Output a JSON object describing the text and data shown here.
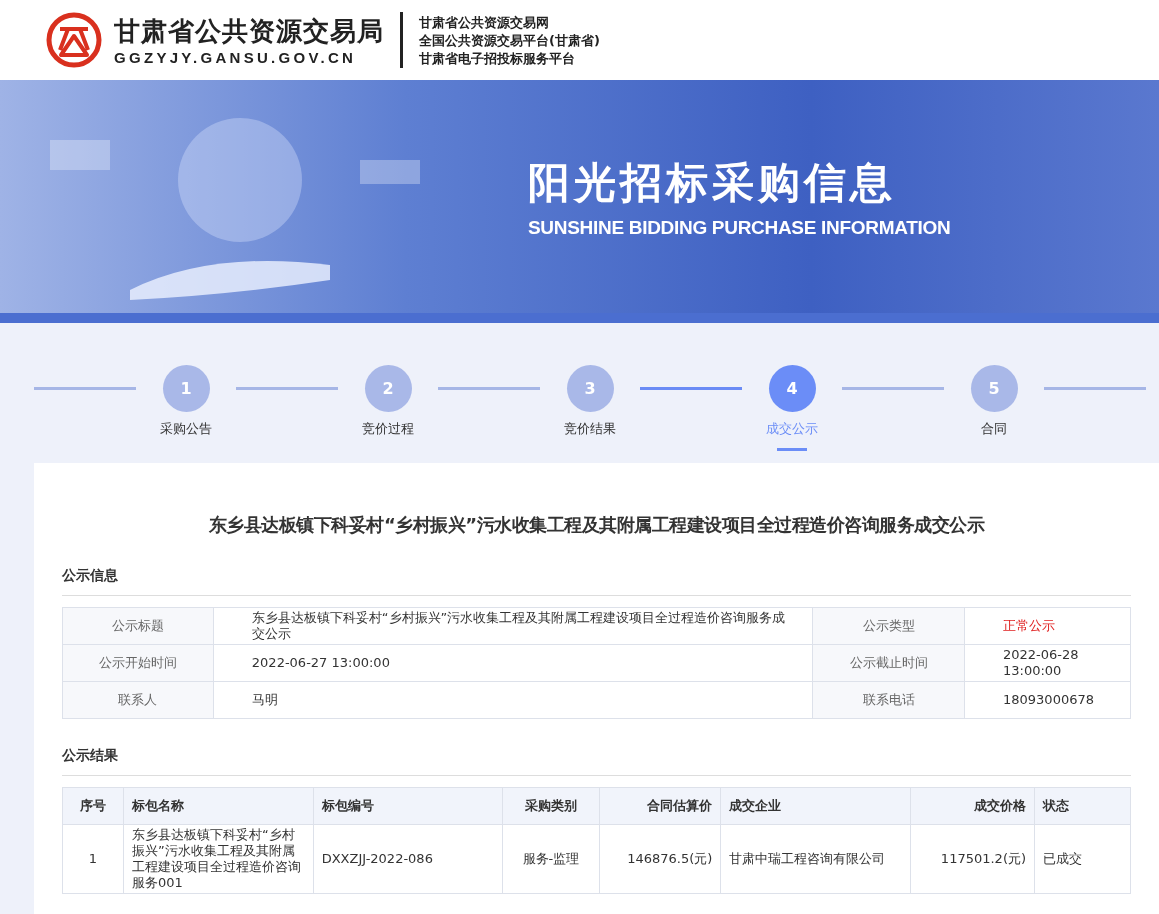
{
  "header": {
    "org_name": "甘肃省公共资源交易局",
    "domain": "GGZYJY.GANSU.GOV.CN",
    "taglines": [
      "甘肃省公共资源交易网",
      "全国公共资源交易平台(甘肃省)",
      "甘肃省电子招投标服务平台"
    ]
  },
  "banner": {
    "title": "阳光招标采购信息",
    "subtitle": "SUNSHINE BIDDING PURCHASE INFORMATION"
  },
  "steps": [
    {
      "number": "1",
      "label": "采购公告",
      "selected": false
    },
    {
      "number": "2",
      "label": "竞价过程",
      "selected": false
    },
    {
      "number": "3",
      "label": "竞价结果",
      "selected": false
    },
    {
      "number": "4",
      "label": "成交公示",
      "selected": true
    },
    {
      "number": "5",
      "label": "合同",
      "selected": false
    }
  ],
  "notice": {
    "title": "东乡县达板镇下科妥村“乡村振兴”污水收集工程及其附属工程建设项目全过程造价咨询服务成交公示",
    "info_heading": "公示信息",
    "info_rows": [
      [
        {
          "label": "公示标题",
          "value": "东乡县达板镇下科妥村“乡村振兴”污水收集工程及其附属工程建设项目全过程造价咨询服务成交公示",
          "alert": false
        },
        {
          "label": "公示类型",
          "value": "正常公示",
          "alert": true
        }
      ],
      [
        {
          "label": "公示开始时间",
          "value": "2022-06-27 13:00:00",
          "alert": false
        },
        {
          "label": "公示截止时间",
          "value": "2022-06-28 13:00:00",
          "alert": false
        }
      ],
      [
        {
          "label": "联系人",
          "value": "马明",
          "alert": false
        },
        {
          "label": "联系电话",
          "value": "18093000678",
          "alert": false
        }
      ]
    ],
    "result_heading": "公示结果",
    "result_columns": [
      "序号",
      "标包名称",
      "标包编号",
      "采购类别",
      "合同估算价",
      "成交企业",
      "成交价格",
      "状态"
    ],
    "result_rows": [
      [
        "1",
        "东乡县达板镇下科妥村“乡村振兴”污水收集工程及其附属工程建设项目全过程造价咨询服务001",
        "DXXZJJ-2022-086",
        "服务-监理",
        "146876.5(元)",
        "甘肃中瑞工程咨询有限公司",
        "117501.2(元)",
        "已成交"
      ]
    ]
  }
}
